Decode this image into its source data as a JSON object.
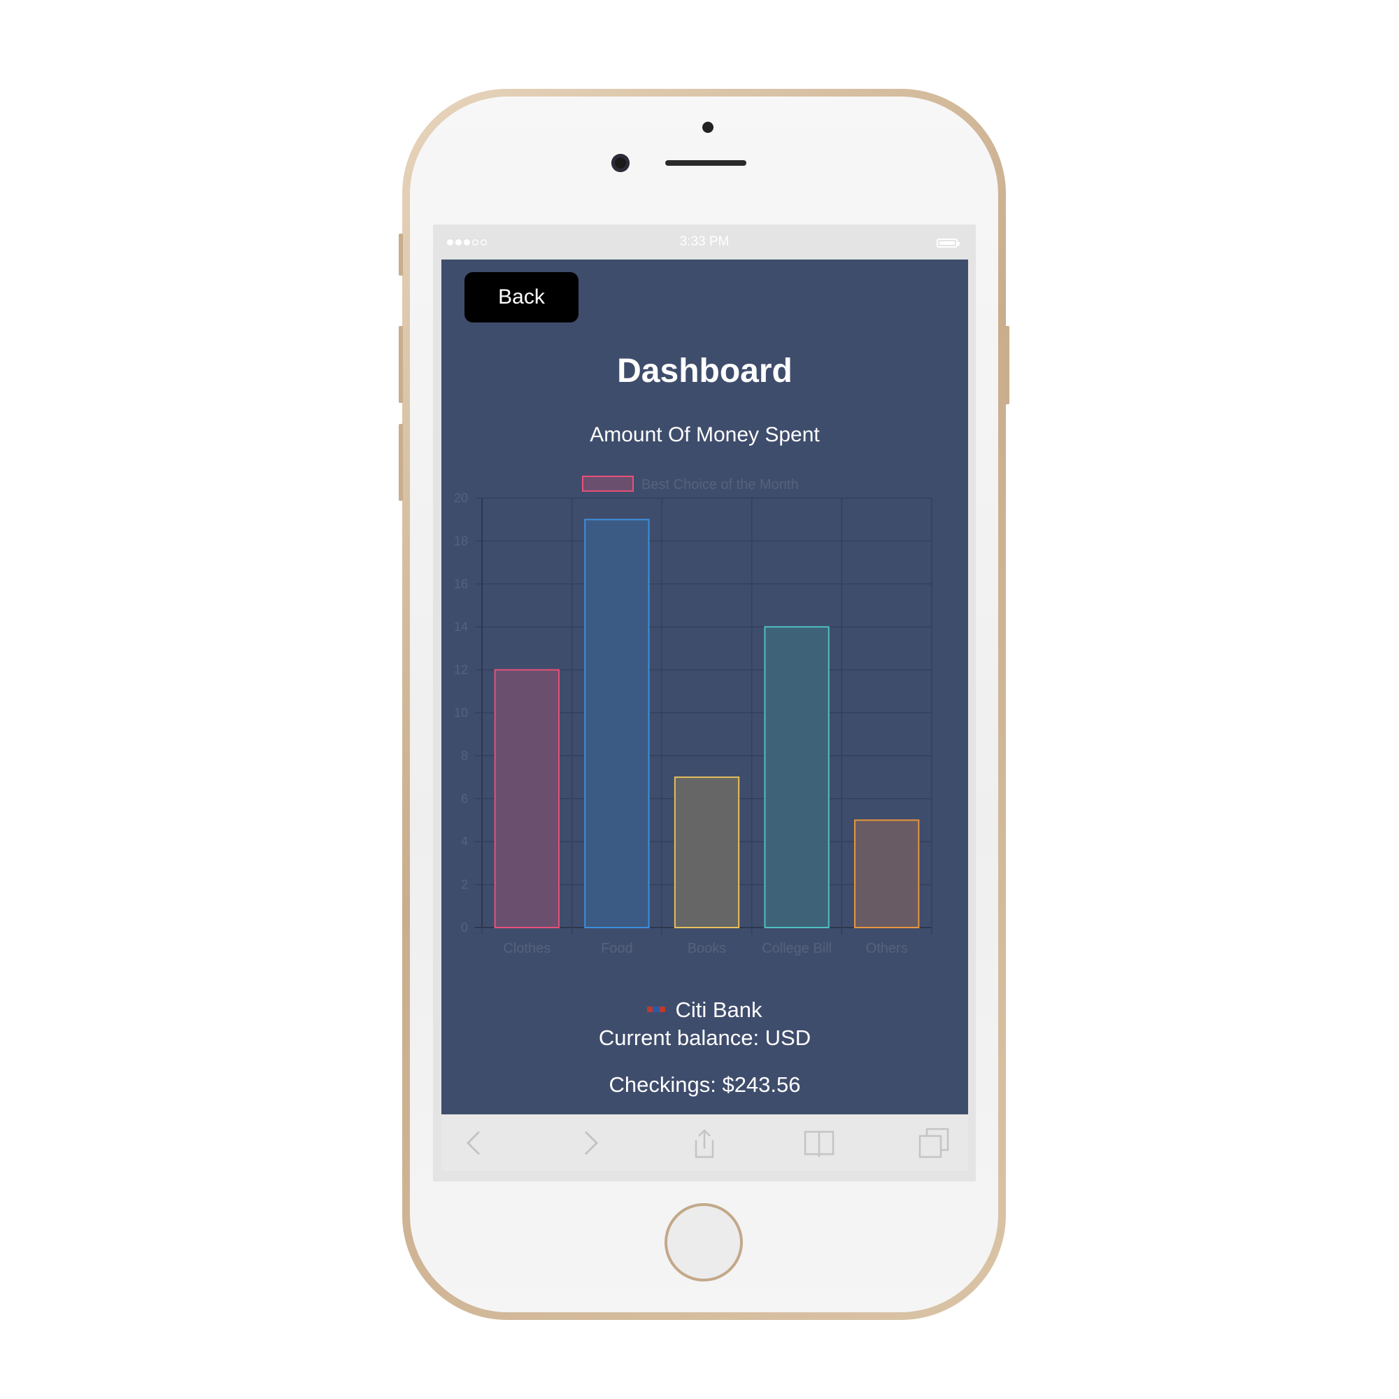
{
  "status_bar": {
    "time": "3:33 PM"
  },
  "app": {
    "back_label": "Back",
    "title": "Dashboard",
    "subtitle": "Amount Of Money Spent",
    "bank_name": "Citi Bank",
    "balance_text": "Current balance: USD",
    "checkings_text": "Checkings: $243.56"
  },
  "toolbar": {
    "icons": [
      "back-arrow-icon",
      "forward-arrow-icon",
      "share-icon",
      "bookmarks-icon",
      "tabs-icon"
    ]
  },
  "colors": {
    "app_background": "#3f4d6c",
    "button_background": "#000000",
    "grid": "#33405c",
    "axis_text": "#56627c"
  },
  "chart_data": {
    "type": "bar",
    "categories": [
      "Clothes",
      "Food",
      "Books",
      "College Bill",
      "Others"
    ],
    "series": [
      {
        "name": "Best Choice of the Month",
        "values": [
          12,
          19,
          7,
          14,
          5
        ]
      }
    ],
    "bar_border_colors": [
      "#e8507a",
      "#3d8fdc",
      "#e8c05a",
      "#4fbfbf",
      "#e8963c"
    ],
    "bar_fill_colors": [
      "#6a4f6e",
      "#3b5b84",
      "#666666",
      "#3e6278",
      "#695b63"
    ],
    "ylim": [
      0,
      20
    ],
    "yticks": [
      0,
      2,
      4,
      6,
      8,
      10,
      12,
      14,
      16,
      18,
      20
    ],
    "grid": true,
    "legend_position": "top"
  }
}
